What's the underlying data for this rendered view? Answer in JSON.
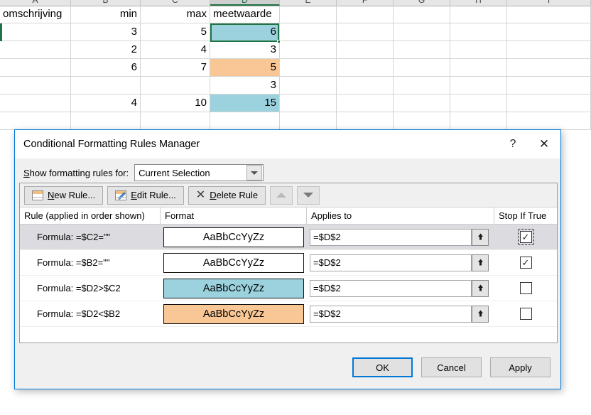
{
  "spreadsheet": {
    "column_headers": [
      "A",
      "B",
      "C",
      "D",
      "E",
      "F",
      "G",
      "H",
      "I"
    ],
    "selected_column": "D",
    "header_row": {
      "a": "omschrijving",
      "b": "min",
      "c": "max",
      "d": "meetwaarde"
    },
    "rows": [
      {
        "a": "",
        "b": "3",
        "c": "5",
        "d": "6",
        "fill": "teal",
        "active": true
      },
      {
        "a": "",
        "b": "2",
        "c": "4",
        "d": "3",
        "fill": "none",
        "active": false
      },
      {
        "a": "",
        "b": "6",
        "c": "7",
        "d": "5",
        "fill": "orange",
        "active": false
      },
      {
        "a": "",
        "b": "",
        "c": "",
        "d": "3",
        "fill": "none",
        "active": false
      },
      {
        "a": "",
        "b": "4",
        "c": "10",
        "d": "15",
        "fill": "teal",
        "active": false
      },
      {
        "a": "",
        "b": "",
        "c": "",
        "d": "",
        "fill": "none",
        "active": false
      }
    ],
    "colors": {
      "teal": "#9BD2DE",
      "orange": "#F9C795",
      "selection_border": "#217346",
      "gridline": "#d4d4d4"
    }
  },
  "dialog": {
    "title": "Conditional Formatting Rules Manager",
    "help_button": "?",
    "close_button": "✕",
    "show_rules_label": "Show formatting rules for:",
    "show_rules_value": "Current Selection",
    "toolbar": {
      "new_rule": "New Rule...",
      "edit_rule": "Edit Rule...",
      "delete_rule": "Delete Rule",
      "move_up": "▲",
      "move_down": "▼"
    },
    "columns": {
      "rule": "Rule (applied in order shown)",
      "format": "Format",
      "applies_to": "Applies to",
      "stop_if_true": "Stop If True"
    },
    "rules": [
      {
        "rule": "Formula: =$C2=\"\"",
        "format_preview": "AaBbCcYyZz",
        "format_fill": "#ffffff",
        "applies_to": "=$D$2",
        "stop_if_true": true,
        "selected": true,
        "focused": true
      },
      {
        "rule": "Formula: =$B2=\"\"",
        "format_preview": "AaBbCcYyZz",
        "format_fill": "#ffffff",
        "applies_to": "=$D$2",
        "stop_if_true": true,
        "selected": false,
        "focused": false
      },
      {
        "rule": "Formula: =$D2>$C2",
        "format_preview": "AaBbCcYyZz",
        "format_fill": "#9BD2DE",
        "applies_to": "=$D$2",
        "stop_if_true": false,
        "selected": false,
        "focused": false
      },
      {
        "rule": "Formula: =$D2<$B2",
        "format_preview": "AaBbCcYyZz",
        "format_fill": "#F9C795",
        "applies_to": "=$D$2",
        "stop_if_true": false,
        "selected": false,
        "focused": false
      }
    ],
    "footer": {
      "ok": "OK",
      "cancel": "Cancel",
      "apply": "Apply"
    },
    "check_glyph": "✓"
  }
}
